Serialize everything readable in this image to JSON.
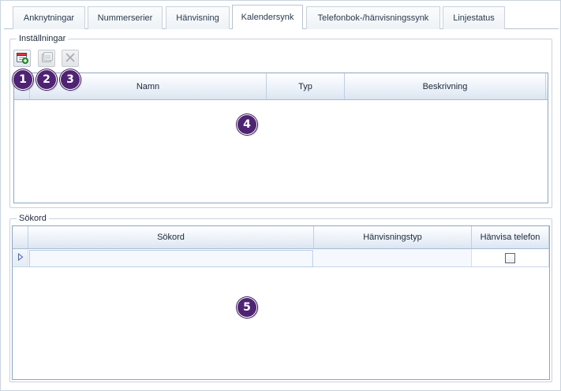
{
  "tabs": [
    {
      "label": "Anknytningar",
      "active": false
    },
    {
      "label": "Nummerserier",
      "active": false
    },
    {
      "label": "Hänvisning",
      "active": false
    },
    {
      "label": "Kalendersynk",
      "active": true
    },
    {
      "label": "Telefonbok-/hänvisningssynk",
      "active": false
    },
    {
      "label": "Linjestatus",
      "active": false
    }
  ],
  "settings": {
    "title": "Inställningar",
    "toolbar": {
      "add_icon": "add-calendar-icon",
      "edit_icon": "edit-calendar-icon",
      "delete_icon": "delete-x-icon"
    },
    "columns": [
      "Namn",
      "Typ",
      "Beskrivning"
    ]
  },
  "keywords": {
    "title": "Sökord",
    "columns": [
      "Sökord",
      "Hänvisningstyp",
      "Hänvisa telefon"
    ],
    "new_row": {
      "sokord": "",
      "hanvisningstyp": "",
      "hanvisa_telefon": false
    }
  },
  "callouts": [
    "1",
    "2",
    "3",
    "4",
    "5"
  ],
  "colors": {
    "callout_bg": "#4f2373",
    "grid_border": "#8ea6c4",
    "header_gradient_end": "#dbe5f1"
  }
}
